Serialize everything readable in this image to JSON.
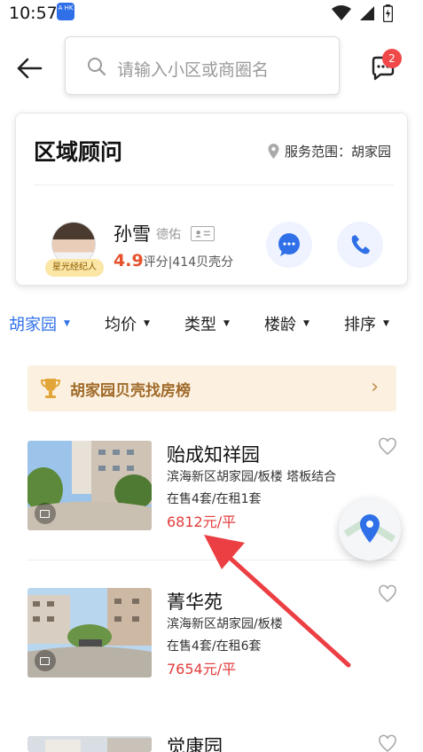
{
  "status": {
    "time": "10:57",
    "app_icon_text": "A HK"
  },
  "search": {
    "placeholder": "请输入小区或商圈名"
  },
  "messages": {
    "badge": "2"
  },
  "advisor": {
    "title": "区域顾问",
    "service_label": "服务范围：胡家园",
    "agent_name": "孙雪",
    "agent_company": "德佑",
    "agent_badge": "星光经纪人",
    "score": "4.9",
    "score_suffix": "评分|414贝壳分"
  },
  "filters": [
    {
      "label": "胡家园",
      "active": true
    },
    {
      "label": "均价"
    },
    {
      "label": "类型"
    },
    {
      "label": "楼龄"
    },
    {
      "label": "排序"
    }
  ],
  "rank_banner": {
    "text": "胡家园贝壳找房榜",
    "arrow": "›"
  },
  "listings": [
    {
      "title": "贻成知祥园",
      "desc": "滨海新区胡家园/板楼 塔板结合",
      "count": "在售4套/在租1套",
      "price": "6812元/平"
    },
    {
      "title": "菁华苑",
      "desc": "滨海新区胡家园/板楼",
      "count": "在售4套/在租6套",
      "price": "7654元/平"
    },
    {
      "title": "觉康园"
    }
  ],
  "colors": {
    "accent": "#2f6fe8",
    "price": "#e23b3b",
    "annotation_arrow": "#ec3f44"
  }
}
